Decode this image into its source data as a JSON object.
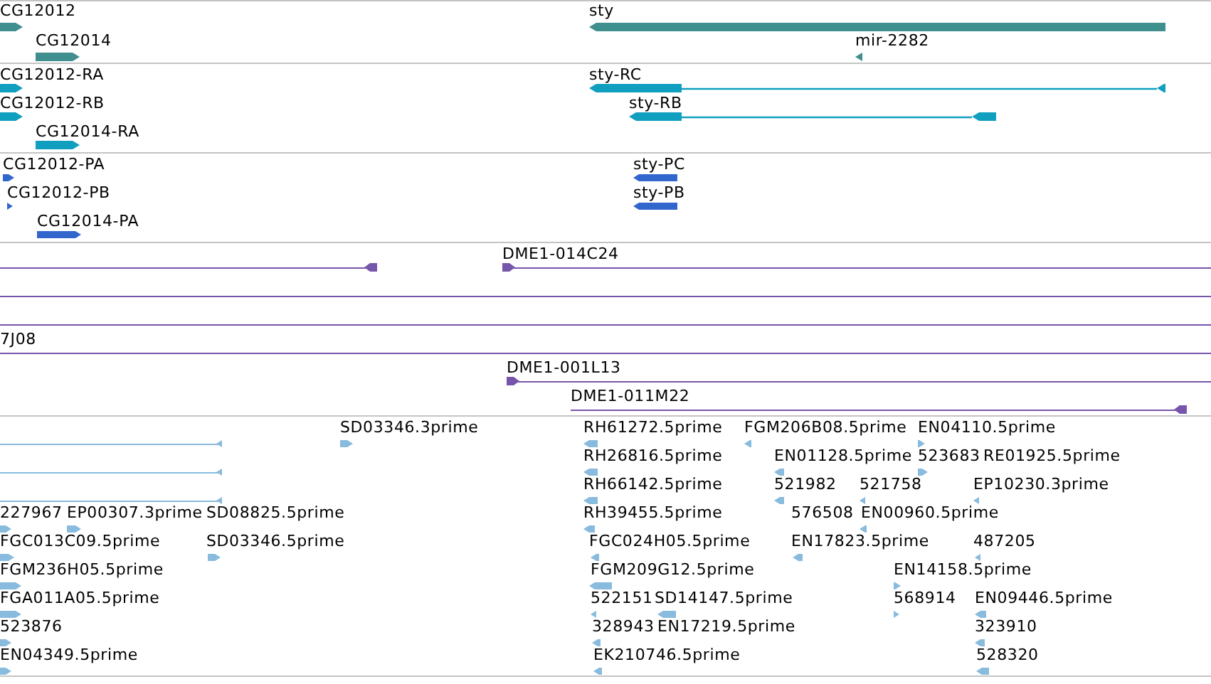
{
  "tracks": [
    {
      "kind": "gene",
      "color": "#3f8f8f",
      "features": [
        {
          "label": "CG12012",
          "kind": "block",
          "reverse": false
        },
        {
          "label": "CG12014",
          "kind": "block",
          "reverse": false
        },
        {
          "label": "sty",
          "kind": "block",
          "reverse": true
        },
        {
          "label": "mir-2282",
          "kind": "block",
          "reverse": true
        }
      ]
    },
    {
      "kind": "transcript",
      "color": "#109fbf",
      "features": [
        {
          "label": "CG12012-RA",
          "kind": "block",
          "reverse": false
        },
        {
          "label": "CG12012-RB",
          "kind": "block",
          "reverse": false
        },
        {
          "label": "CG12014-RA",
          "kind": "block",
          "reverse": false
        },
        {
          "label": "sty-RC",
          "kind": "spliced",
          "reverse": true
        },
        {
          "label": "sty-RB",
          "kind": "spliced",
          "reverse": true
        }
      ]
    },
    {
      "kind": "protein",
      "color": "#3366cc",
      "features": [
        {
          "label": "CG12012-PA",
          "kind": "block",
          "reverse": false
        },
        {
          "label": "CG12012-PB",
          "kind": "block",
          "reverse": false
        },
        {
          "label": "CG12014-PA",
          "kind": "block",
          "reverse": false
        },
        {
          "label": "sty-PC",
          "kind": "block",
          "reverse": true
        },
        {
          "label": "sty-PB",
          "kind": "block",
          "reverse": true
        }
      ]
    },
    {
      "kind": "clone",
      "color": "#7755aa",
      "features": [
        {
          "kind": "line",
          "reverse": false
        },
        {
          "label": "DME1-014C24",
          "kind": "line",
          "reverse": true
        },
        {
          "kind": "rule"
        },
        {
          "kind": "rule"
        },
        {
          "label": "7J08",
          "kind": "rule"
        },
        {
          "label": "DME1-001L13",
          "kind": "line",
          "reverse": true
        },
        {
          "label": "DME1-011M22",
          "kind": "line",
          "reverse": false
        }
      ]
    },
    {
      "kind": "est",
      "color": "#88bbdd",
      "features": [
        {
          "kind": "line",
          "reverse": false
        },
        {
          "label": "SD03346.3prime",
          "kind": "block",
          "reverse": false
        },
        {
          "label": "RH61272.5prime",
          "kind": "block",
          "reverse": true
        },
        {
          "label": "FGM206B08.5prime",
          "kind": "block",
          "reverse": true
        },
        {
          "label": "EN04110.5prime",
          "kind": "block",
          "reverse": false
        },
        {
          "kind": "line",
          "reverse": false
        },
        {
          "label": "RH26816.5prime",
          "kind": "block",
          "reverse": true
        },
        {
          "label": "EN01128.5prime",
          "kind": "block",
          "reverse": true
        },
        {
          "label": "523683",
          "kind": "block",
          "reverse": false
        },
        {
          "label": "RE01925.5prime"
        },
        {
          "kind": "line",
          "reverse": false
        },
        {
          "label": "RH66142.5prime",
          "kind": "block",
          "reverse": true
        },
        {
          "label": "521982",
          "kind": "block",
          "reverse": true
        },
        {
          "label": "521758",
          "kind": "block",
          "reverse": true
        },
        {
          "label": "EP10230.3prime",
          "kind": "block",
          "reverse": true
        },
        {
          "label": "227967",
          "kind": "block",
          "reverse": false
        },
        {
          "label": "EP00307.3prime",
          "kind": "block",
          "reverse": false
        },
        {
          "label": "SD08825.5prime"
        },
        {
          "label": "RH39455.5prime",
          "kind": "block",
          "reverse": true
        },
        {
          "label": "576508"
        },
        {
          "label": "EN00960.5prime",
          "kind": "block",
          "reverse": true
        },
        {
          "label": "FGC013C09.5prime",
          "kind": "block",
          "reverse": false
        },
        {
          "label": "SD03346.5prime",
          "kind": "block",
          "reverse": false
        },
        {
          "label": "FGC024H05.5prime",
          "kind": "block",
          "reverse": true
        },
        {
          "label": "EN17823.5prime",
          "kind": "block",
          "reverse": true
        },
        {
          "label": "487205",
          "kind": "block",
          "reverse": true
        },
        {
          "label": "FGM236H05.5prime",
          "kind": "block",
          "reverse": false
        },
        {
          "label": "FGM209G12.5prime",
          "kind": "block",
          "reverse": true
        },
        {
          "label": "EN14158.5prime",
          "kind": "block",
          "reverse": false
        },
        {
          "label": "FGA011A05.5prime",
          "kind": "block",
          "reverse": false
        },
        {
          "label": "522151",
          "kind": "block",
          "reverse": true
        },
        {
          "label": "SD14147.5prime",
          "kind": "block",
          "reverse": true
        },
        {
          "label": "568914",
          "kind": "block",
          "reverse": false
        },
        {
          "label": "EN09446.5prime",
          "kind": "block",
          "reverse": true
        },
        {
          "label": "523876",
          "kind": "block",
          "reverse": false
        },
        {
          "label": "328943",
          "kind": "block",
          "reverse": true
        },
        {
          "label": "EN17219.5prime"
        },
        {
          "label": "323910",
          "kind": "block",
          "reverse": true
        },
        {
          "label": "EN04349.5prime",
          "kind": "block",
          "reverse": false
        },
        {
          "label": "EK210746.5prime",
          "kind": "block",
          "reverse": true
        },
        {
          "label": "528320",
          "kind": "block",
          "reverse": true
        }
      ]
    }
  ]
}
